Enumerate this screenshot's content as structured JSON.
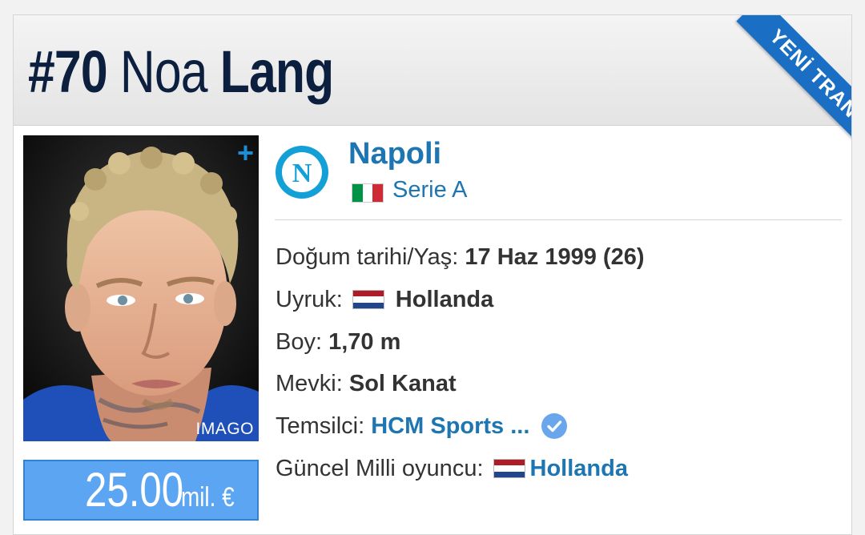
{
  "header": {
    "number": "#70",
    "first_name": "Noa",
    "last_name": "Lang",
    "ribbon": "YENİ TRANSFER"
  },
  "photo": {
    "credit": "IMAGO",
    "plus_icon": "+"
  },
  "market_value": {
    "amount": "25.00",
    "unit": "mil. €"
  },
  "club": {
    "name": "Napoli",
    "logo_letter": "N",
    "league": "Serie A",
    "league_flag_colors": [
      "#009246",
      "#ffffff",
      "#ce2b37"
    ]
  },
  "details": {
    "birth_label": "Doğum tarihi/Yaş:",
    "birth_value": "17 Haz 1999 (26)",
    "nationality_label": "Uyruk:",
    "nationality_value": "Hollanda",
    "height_label": "Boy:",
    "height_value": "1,70 m",
    "position_label": "Mevki:",
    "position_value": "Sol Kanat",
    "agent_label": "Temsilci:",
    "agent_value": "HCM Sports ...",
    "national_label": "Güncel Milli oyuncu:",
    "national_value": "Hollanda"
  },
  "colors": {
    "accent": "#1d75b2",
    "value_bg": "#5ba5f2",
    "ribbon": "#1a6fc4",
    "title": "#0c1f3f"
  }
}
